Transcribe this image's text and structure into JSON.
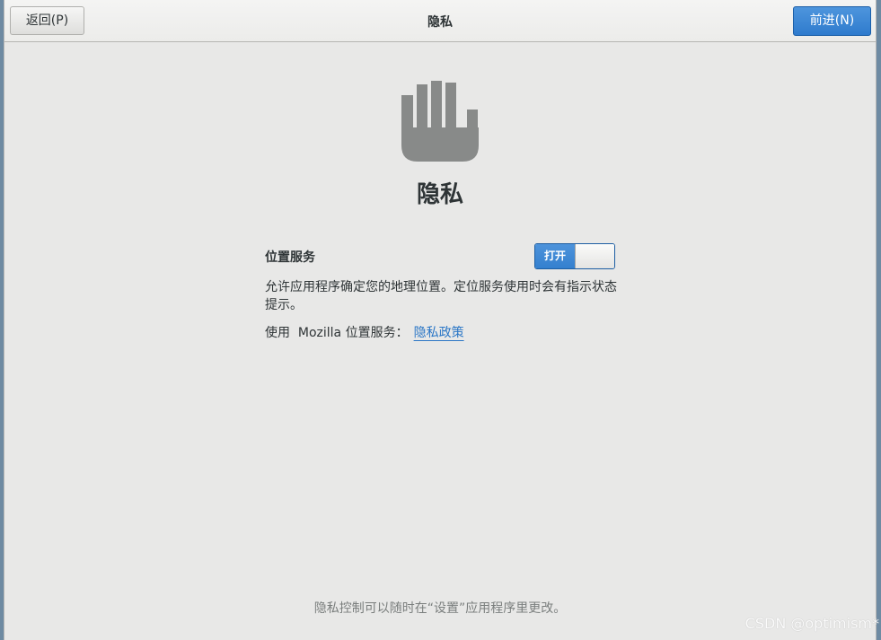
{
  "header": {
    "title": "隐私",
    "back_label": "返回(P)",
    "next_label": "前进(N)"
  },
  "main": {
    "icon": "hand-stop-icon",
    "title": "隐私",
    "location_label": "位置服务",
    "switch": {
      "state_label": "打开",
      "on": true
    },
    "description": "允许应用程序确定您的地理位置。定位服务使用时会有指示状态提示。",
    "mozilla_prefix": "使用  Mozilla 位置服务：",
    "privacy_link": "隐私政策"
  },
  "footer": {
    "note": "隐私控制可以随时在“设置”应用程序里更改。"
  },
  "watermark": "CSDN @optimism*",
  "colors": {
    "accent": "#3480cf",
    "link": "#2a76c6",
    "icon": "#888a89"
  }
}
